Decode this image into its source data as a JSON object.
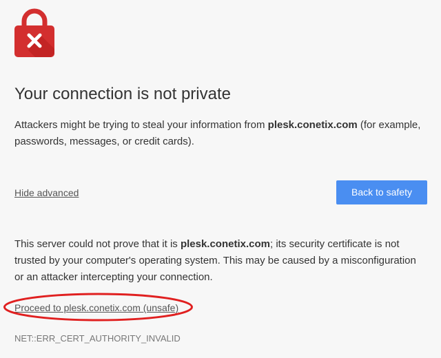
{
  "title": "Your connection is not private",
  "intro": {
    "before": "Attackers might be trying to steal your information from ",
    "domain": "plesk.conetix.com",
    "after": " (for example, passwords, messages, or credit cards)."
  },
  "hide_advanced_label": "Hide advanced",
  "back_button_label": "Back to safety",
  "details": {
    "before": "This server could not prove that it is ",
    "domain": "plesk.conetix.com",
    "after": "; its security certificate is not trusted by your computer's operating system. This may be caused by a misconfiguration or an attacker intercepting your connection."
  },
  "proceed_label": "Proceed to plesk.conetix.com (unsafe)",
  "error_code": "NET::ERR_CERT_AUTHORITY_INVALID",
  "colors": {
    "lock": "#d32f2f",
    "button": "#4a8ef1",
    "annotation_circle": "#e02020"
  },
  "icons": {
    "lock": "lock-error-icon"
  }
}
